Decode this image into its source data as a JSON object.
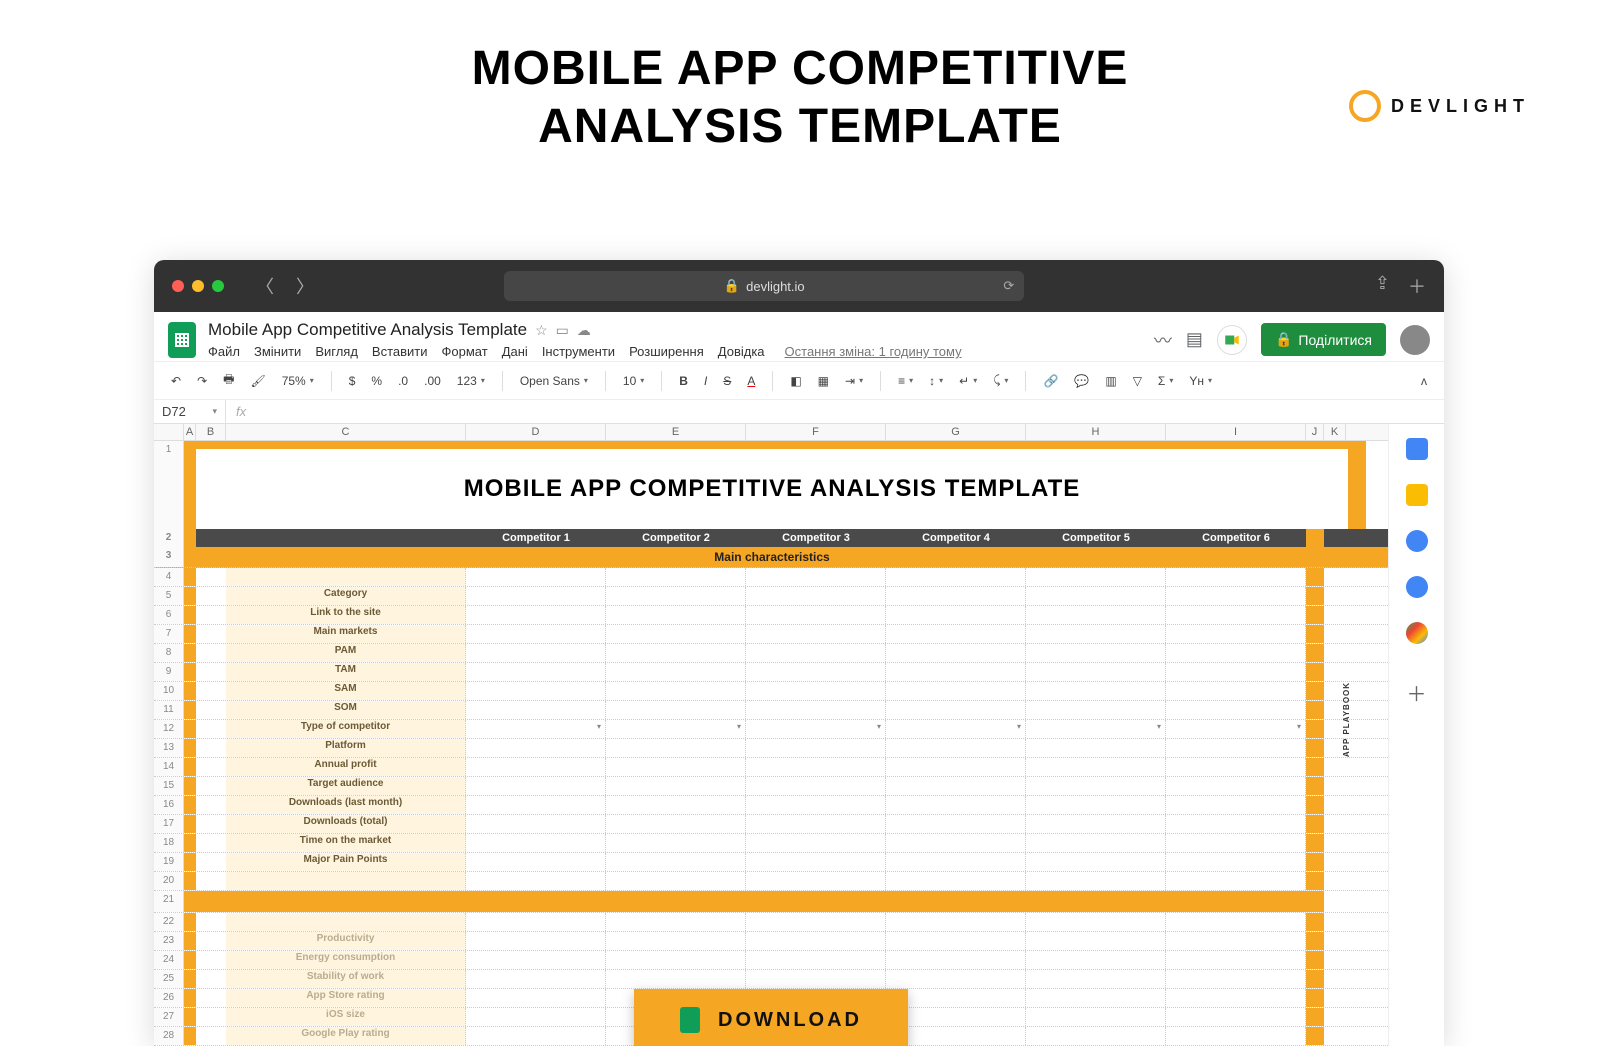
{
  "page": {
    "title_line1": "MOBILE APP COMPETITIVE",
    "title_line2": "ANALYSIS TEMPLATE"
  },
  "brand": {
    "name": "DEVLIGHT"
  },
  "browser": {
    "url_host": "devlight.io",
    "lock": "🔒"
  },
  "doc": {
    "title": "Mobile App Competitive Analysis Template",
    "menus": [
      "Файл",
      "Змінити",
      "Вигляд",
      "Вставити",
      "Формат",
      "Дані",
      "Інструменти",
      "Розширення",
      "Довідка"
    ],
    "last_edit": "Остання зміна: 1 годину тому",
    "share": "Поділитися"
  },
  "toolbar": {
    "zoom": "75%",
    "font": "Open Sans",
    "size": "10",
    "decimals": ".0",
    "decimals2": ".00",
    "format123": "123",
    "currency": "$",
    "percent": "%",
    "script": "Yн"
  },
  "namebox": {
    "cell": "D72",
    "fx": "fx"
  },
  "columns": [
    "A",
    "B",
    "C",
    "D",
    "E",
    "F",
    "G",
    "H",
    "I",
    "J",
    "K"
  ],
  "sheet": {
    "big_title": "MOBILE APP COMPETITIVE ANALYSIS TEMPLATE",
    "playbook": "APP PLAYBOOK",
    "competitors": [
      "Competitor 1",
      "Competitor 2",
      "Competitor 3",
      "Competitor 4",
      "Competitor 5",
      "Competitor 6"
    ],
    "section_main": "Main characteristics",
    "fields_main": [
      "Category",
      "Link to the site",
      "Main markets",
      "PAM",
      "TAM",
      "SAM",
      "SOM",
      "Type of competitor",
      "Platform",
      "Annual profit",
      "Target audience",
      "Downloads (last month)",
      "Downloads (total)",
      "Time on the market",
      "Major Pain Points"
    ],
    "dropdown_row_index": 7,
    "fields_after": [
      "Productivity",
      "Energy consumption",
      "Stability of work",
      "App Store rating",
      "iOS size",
      "Google Play rating"
    ]
  },
  "download": {
    "label": "DOWNLOAD"
  },
  "sidepanel_colors": [
    "#4285f4",
    "#fbbc04",
    "#4285f4",
    "#ea4335",
    "#34a853"
  ]
}
